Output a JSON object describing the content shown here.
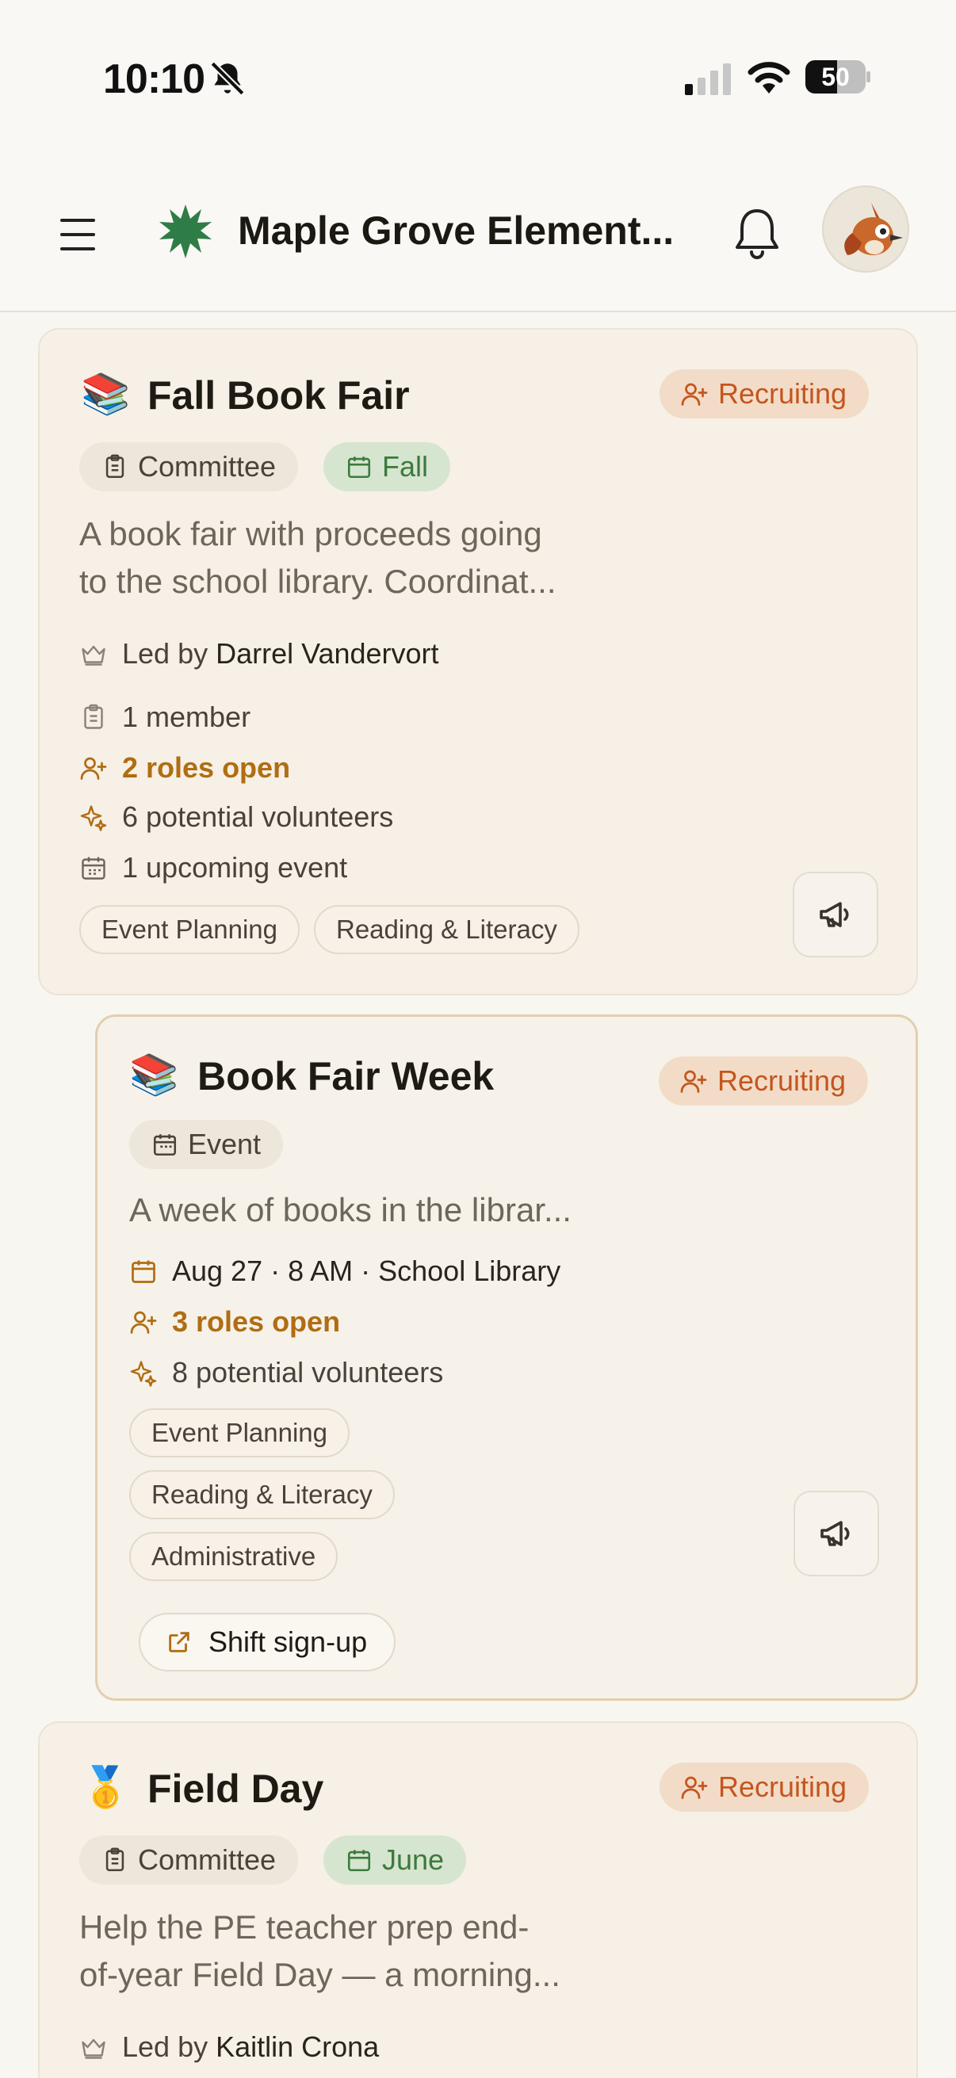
{
  "status_bar": {
    "time": "10:10",
    "battery": "50"
  },
  "header": {
    "title": "Maple Grove Element..."
  },
  "cards": [
    {
      "emoji": "📚",
      "title": "Fall Book Fair",
      "status": "Recruiting",
      "type": "Committee",
      "season": "Fall",
      "description": [
        "A book fair with proceeds going",
        "to the school library. Coordinat..."
      ],
      "led_by_prefix": "Led by",
      "led_by_name": "Darrel Vandervort",
      "members": "1 member",
      "roles_open": "2 roles open",
      "potential_volunteers": "6 potential volunteers",
      "upcoming_events": "1 upcoming event",
      "tags": [
        "Event Planning",
        "Reading & Literacy"
      ]
    },
    {
      "emoji": "📚",
      "title": "Book Fair Week",
      "status": "Recruiting",
      "type": "Event",
      "description": [
        "A week of books in the librar..."
      ],
      "when_where": "Aug 27 · 8 AM · School Library",
      "roles_open": "3 roles open",
      "potential_volunteers": "8 potential volunteers",
      "tags": [
        "Event Planning",
        "Reading & Literacy",
        "Administrative"
      ],
      "shift_signup": "Shift sign-up"
    },
    {
      "emoji": "🥇",
      "title": "Field Day",
      "status": "Recruiting",
      "type": "Committee",
      "season": "June",
      "description": [
        "Help the PE teacher prep end-",
        "of-year Field Day — a morning..."
      ],
      "led_by_prefix": "Led by",
      "led_by_name": "Kaitlin Crona"
    }
  ],
  "colors": {
    "background": "#f8f6f1",
    "card": "#f6f0e6",
    "recruiting_text": "#c4551e",
    "recruiting_bg": "#f2dcc7",
    "roles_open": "#b06d12",
    "season_green": "#3b7a3e",
    "logo_green": "#2e7d46"
  },
  "icons": {
    "menu": "hamburger-icon",
    "logo": "maple-leaf-star-icon",
    "notifications": "bell-icon",
    "silent": "bell-slash-icon",
    "recruiting": "user-plus-icon",
    "committee": "clipboard-icon",
    "season": "calendar-icon",
    "leader": "crown-icon",
    "volunteers": "sparkles-icon",
    "announce": "megaphone-icon",
    "external": "external-link-icon"
  }
}
